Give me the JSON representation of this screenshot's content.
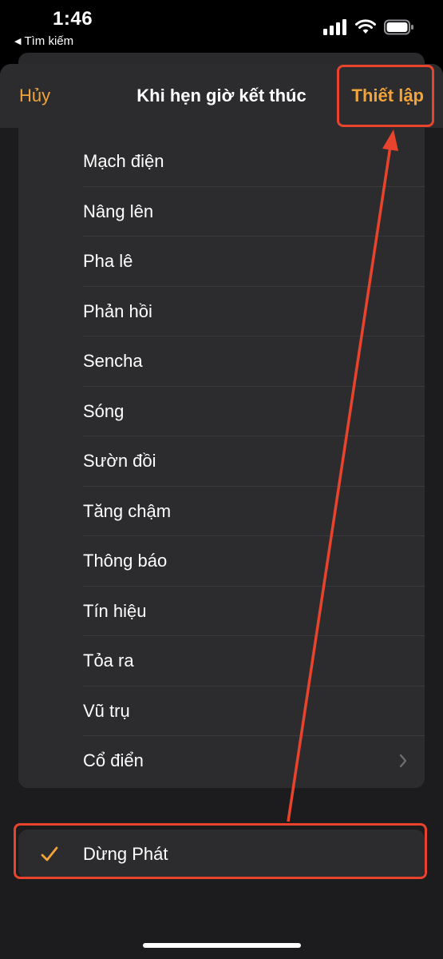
{
  "status": {
    "time": "1:46",
    "back_app": "Tìm kiếm",
    "back_icon": "back-triangle-icon"
  },
  "nav": {
    "cancel": "Hủy",
    "title": "Khi hẹn giờ kết thúc",
    "set": "Thiết lập"
  },
  "tones": [
    {
      "label": "Mạch điện"
    },
    {
      "label": "Nâng lên"
    },
    {
      "label": "Pha lê"
    },
    {
      "label": "Phản hồi"
    },
    {
      "label": "Sencha"
    },
    {
      "label": "Sóng"
    },
    {
      "label": "Sườn đồi"
    },
    {
      "label": "Tăng chậm"
    },
    {
      "label": "Thông báo"
    },
    {
      "label": "Tín hiệu"
    },
    {
      "label": "Tỏa ra"
    },
    {
      "label": "Vũ trụ"
    },
    {
      "label": "Cổ điển",
      "disclosure": true
    }
  ],
  "stop_option": {
    "label": "Dừng Phát",
    "selected": true
  },
  "colors": {
    "accent": "#f2a33a",
    "annotation": "#e8432d",
    "cell_bg": "#2c2c2e",
    "sheet_bg": "#1c1c1e"
  }
}
